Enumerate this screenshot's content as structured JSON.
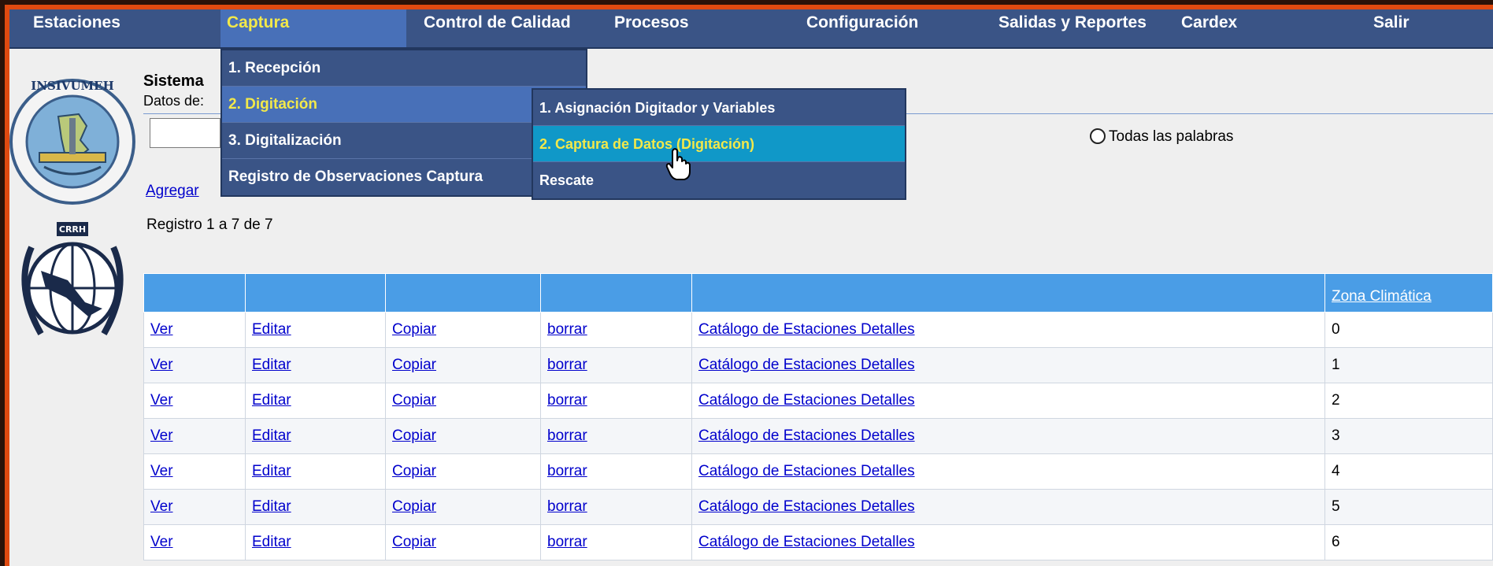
{
  "menubar": {
    "items": [
      {
        "label": "Estaciones",
        "active": false
      },
      {
        "label": "Captura",
        "active": true
      },
      {
        "label": "Control de Calidad",
        "active": false
      },
      {
        "label": "Procesos",
        "active": false
      },
      {
        "label": "Configuración",
        "active": false
      },
      {
        "label": "Salidas y Reportes",
        "active": false
      },
      {
        "label": "Cardex",
        "active": false
      },
      {
        "label": "Salir",
        "active": false
      }
    ]
  },
  "dropdown": {
    "items": [
      {
        "label": "1. Recepción"
      },
      {
        "label": "2. Digitación"
      },
      {
        "label": "3. Digitalización"
      },
      {
        "label": "Registro de Observaciones Captura"
      }
    ]
  },
  "submenu": {
    "items": [
      {
        "label": "1. Asignación Digitador y Variables"
      },
      {
        "label": "2. Captura de Datos (Digitación)"
      },
      {
        "label": "Rescate"
      }
    ]
  },
  "header": {
    "system_title": "Sistema",
    "data_label": "Datos de:",
    "search_value": "",
    "radio_all_words": "Todas las palabras",
    "add_link": "Agregar",
    "record_count": "Registro 1 a 7 de 7"
  },
  "logos": {
    "insivumeh_text": "INSIVUMEH",
    "crrh_text": "CRRH"
  },
  "table": {
    "sort_header": "Zona Climática",
    "rows": [
      {
        "ver": "Ver",
        "editar": "Editar",
        "copiar": "Copiar",
        "borrar": "borrar",
        "detalle": "Catálogo de Estaciones Detalles",
        "zona": "0"
      },
      {
        "ver": "Ver",
        "editar": "Editar",
        "copiar": "Copiar",
        "borrar": "borrar",
        "detalle": "Catálogo de Estaciones Detalles",
        "zona": "1"
      },
      {
        "ver": "Ver",
        "editar": "Editar",
        "copiar": "Copiar",
        "borrar": "borrar",
        "detalle": "Catálogo de Estaciones Detalles",
        "zona": "2"
      },
      {
        "ver": "Ver",
        "editar": "Editar",
        "copiar": "Copiar",
        "borrar": "borrar",
        "detalle": "Catálogo de Estaciones Detalles",
        "zona": "3"
      },
      {
        "ver": "Ver",
        "editar": "Editar",
        "copiar": "Copiar",
        "borrar": "borrar",
        "detalle": "Catálogo de Estaciones Detalles",
        "zona": "4"
      },
      {
        "ver": "Ver",
        "editar": "Editar",
        "copiar": "Copiar",
        "borrar": "borrar",
        "detalle": "Catálogo de Estaciones Detalles",
        "zona": "5"
      },
      {
        "ver": "Ver",
        "editar": "Editar",
        "copiar": "Copiar",
        "borrar": "borrar",
        "detalle": "Catálogo de Estaciones Detalles",
        "zona": "6"
      }
    ]
  },
  "colors": {
    "frame": "#e04a10",
    "menubar": "#3a5486",
    "menu_active": "#4870b8",
    "highlight_text": "#f2e84a",
    "submenu_highlight": "#1098c8",
    "table_header": "#4a9de6",
    "link": "#0000cc"
  }
}
